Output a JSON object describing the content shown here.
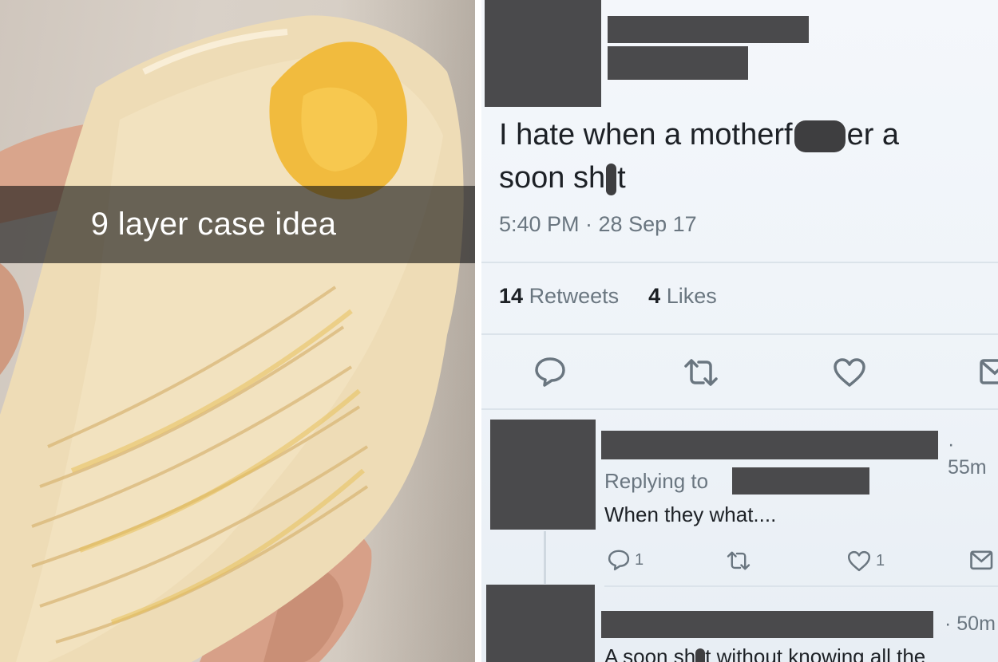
{
  "snap": {
    "caption": "9 layer case idea"
  },
  "tweet": {
    "text_part1": "I hate when a motherf",
    "text_part2": "er a",
    "text_line2_part1": "soon sh",
    "text_line2_part2": "t",
    "meta": "5:40 PM · 28 Sep 17",
    "retweets_count": "14",
    "retweets_label": "Retweets",
    "likes_count": "4",
    "likes_label": "Likes",
    "actions": [
      "comment-icon",
      "retweet-icon",
      "heart-icon",
      "message-icon"
    ]
  },
  "replies": [
    {
      "time": "· 55m",
      "replying_label": "Replying to",
      "text": "When they what....",
      "comment_count": "1",
      "like_count": "1"
    },
    {
      "time": "· 50m",
      "text": "A soon sh",
      "text_rest": "t without knowing all the"
    }
  ],
  "colors": {
    "redaction": "#4a4a4c",
    "muted_text": "#6a7680",
    "primary_text": "#1d2126",
    "tweet_bg": "#f0f4f8"
  }
}
